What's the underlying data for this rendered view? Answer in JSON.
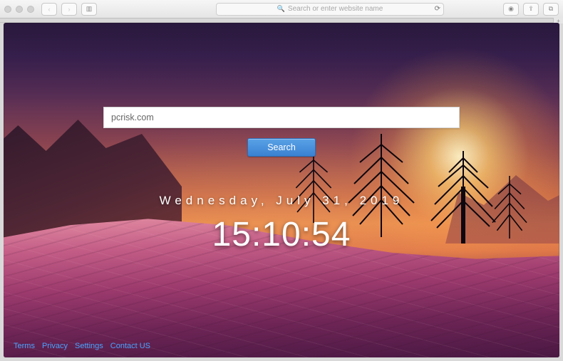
{
  "browser": {
    "url_placeholder": "Search or enter website name",
    "back_glyph": "‹",
    "forward_glyph": "›",
    "sidebar_glyph": "▥",
    "reload_glyph": "⟳",
    "share_glyph": "⇪",
    "tabs_glyph": "⧉",
    "downloads_glyph": "◉",
    "newtab_glyph": "+"
  },
  "search": {
    "value": "pcrisk.com",
    "button_label": "Search"
  },
  "clock": {
    "date_text": "Wednesday, July 31, 2019",
    "time_text": "15:10:54"
  },
  "footer": {
    "links": {
      "terms": "Terms",
      "privacy": "Privacy",
      "settings": "Settings",
      "contact": "Contact US"
    }
  },
  "colors": {
    "button_bg": "#3f86d6",
    "link": "#4aa3ff"
  }
}
